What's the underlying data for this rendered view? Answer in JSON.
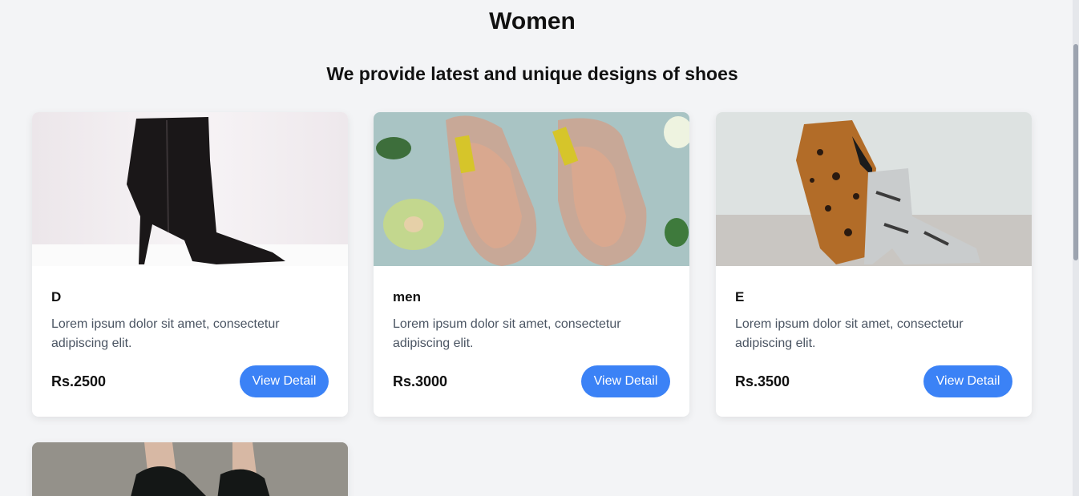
{
  "page": {
    "title": "Women",
    "subtitle": "We provide latest and unique designs of shoes"
  },
  "products": [
    {
      "name": "D",
      "description": "Lorem ipsum dolor sit amet, consectetur adipiscing elit.",
      "price": "Rs.2500",
      "button": "View Detail",
      "image": "black-stiletto-ankle-boot"
    },
    {
      "name": "men",
      "description": "Lorem ipsum dolor sit amet, consectetur adipiscing elit.",
      "price": "Rs.3000",
      "button": "View Detail",
      "image": "glitter-heels-with-flowers"
    },
    {
      "name": "E",
      "description": "Lorem ipsum dolor sit amet, consectetur adipiscing elit.",
      "price": "Rs.3500",
      "button": "View Detail",
      "image": "leopard-and-snakeskin-boots"
    },
    {
      "image": "black-ankle-boots-partial"
    }
  ],
  "colors": {
    "accent": "#3b82f6",
    "background": "#f3f4f6"
  }
}
